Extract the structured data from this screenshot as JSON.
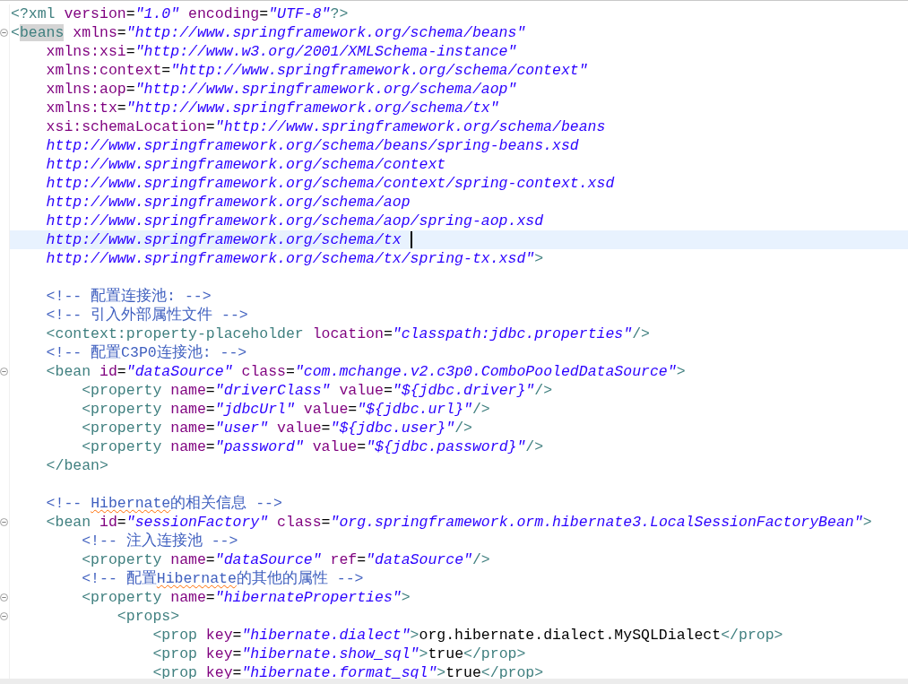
{
  "lines": [
    {
      "selected": false,
      "foldable": false,
      "tokens": [
        {
          "kind": "tag",
          "text": "<?xml"
        },
        {
          "kind": "attr",
          "text": " version"
        },
        {
          "kind": "text",
          "text": "="
        },
        {
          "kind": "value",
          "text": "\"1.0\""
        },
        {
          "kind": "attr",
          "text": " encoding"
        },
        {
          "kind": "text",
          "text": "="
        },
        {
          "kind": "value",
          "text": "\"UTF-8\""
        },
        {
          "kind": "tag",
          "text": "?>"
        }
      ]
    },
    {
      "selected": false,
      "foldable": true,
      "tokens": [
        {
          "kind": "tag",
          "text": "<"
        },
        {
          "kind": "tag-marked",
          "text": "beans"
        },
        {
          "kind": "attr",
          "text": " xmlns"
        },
        {
          "kind": "text",
          "text": "="
        },
        {
          "kind": "value",
          "text": "\"http://www.springframework.org/schema/beans\""
        }
      ]
    },
    {
      "selected": false,
      "foldable": false,
      "tokens": [
        {
          "kind": "attr",
          "text": "    xmlns:xsi"
        },
        {
          "kind": "text",
          "text": "="
        },
        {
          "kind": "value",
          "text": "\"http://www.w3.org/2001/XMLSchema-instance\""
        }
      ]
    },
    {
      "selected": false,
      "foldable": false,
      "tokens": [
        {
          "kind": "attr",
          "text": "    xmlns:context"
        },
        {
          "kind": "text",
          "text": "="
        },
        {
          "kind": "value",
          "text": "\"http://www.springframework.org/schema/context\""
        }
      ]
    },
    {
      "selected": false,
      "foldable": false,
      "tokens": [
        {
          "kind": "attr",
          "text": "    xmlns:aop"
        },
        {
          "kind": "text",
          "text": "="
        },
        {
          "kind": "value",
          "text": "\"http://www.springframework.org/schema/aop\""
        }
      ]
    },
    {
      "selected": false,
      "foldable": false,
      "tokens": [
        {
          "kind": "attr",
          "text": "    xmlns:tx"
        },
        {
          "kind": "text",
          "text": "="
        },
        {
          "kind": "value",
          "text": "\"http://www.springframework.org/schema/tx\""
        }
      ]
    },
    {
      "selected": false,
      "foldable": false,
      "tokens": [
        {
          "kind": "attr",
          "text": "    xsi:schemaLocation"
        },
        {
          "kind": "text",
          "text": "="
        },
        {
          "kind": "value",
          "text": "\"http://www.springframework.org/schema/beans"
        }
      ]
    },
    {
      "selected": false,
      "foldable": false,
      "tokens": [
        {
          "kind": "value",
          "text": "    http://www.springframework.org/schema/beans/spring-beans.xsd"
        }
      ]
    },
    {
      "selected": false,
      "foldable": false,
      "tokens": [
        {
          "kind": "value",
          "text": "    http://www.springframework.org/schema/context"
        }
      ]
    },
    {
      "selected": false,
      "foldable": false,
      "tokens": [
        {
          "kind": "value",
          "text": "    http://www.springframework.org/schema/context/spring-context.xsd"
        }
      ]
    },
    {
      "selected": false,
      "foldable": false,
      "tokens": [
        {
          "kind": "value",
          "text": "    http://www.springframework.org/schema/aop"
        }
      ]
    },
    {
      "selected": false,
      "foldable": false,
      "tokens": [
        {
          "kind": "value",
          "text": "    http://www.springframework.org/schema/aop/spring-aop.xsd"
        }
      ]
    },
    {
      "selected": true,
      "foldable": false,
      "tokens": [
        {
          "kind": "value",
          "text": "    http://www.springframework.org/schema/tx"
        }
      ]
    },
    {
      "selected": false,
      "foldable": false,
      "tokens": [
        {
          "kind": "value",
          "text": "    http://www.springframework.org/schema/tx/spring-tx.xsd\""
        },
        {
          "kind": "tag",
          "text": ">"
        }
      ]
    },
    {
      "selected": false,
      "foldable": false
    },
    {
      "selected": false,
      "foldable": false,
      "tokens": [
        {
          "kind": "comment",
          "text": "    <!-- 配置连接池: -->"
        }
      ]
    },
    {
      "selected": false,
      "foldable": false,
      "tokens": [
        {
          "kind": "comment",
          "text": "    <!-- 引入外部属性文件 -->"
        }
      ]
    },
    {
      "selected": false,
      "foldable": false,
      "tokens": [
        {
          "kind": "tag",
          "text": "    <context:property-placeholder"
        },
        {
          "kind": "attr",
          "text": " location"
        },
        {
          "kind": "text",
          "text": "="
        },
        {
          "kind": "value",
          "text": "\"classpath:jdbc.properties\""
        },
        {
          "kind": "tag",
          "text": "/>"
        }
      ]
    },
    {
      "selected": false,
      "foldable": false,
      "tokens": [
        {
          "kind": "comment",
          "text": "    <!-- 配置C3P0连接池: -->"
        }
      ]
    },
    {
      "selected": false,
      "foldable": true,
      "tokens": [
        {
          "kind": "tag",
          "text": "    <bean"
        },
        {
          "kind": "attr",
          "text": " id"
        },
        {
          "kind": "text",
          "text": "="
        },
        {
          "kind": "value",
          "text": "\"dataSource\""
        },
        {
          "kind": "attr",
          "text": " class"
        },
        {
          "kind": "text",
          "text": "="
        },
        {
          "kind": "value",
          "text": "\"com.mchange.v2.c3p0.ComboPooledDataSource\""
        },
        {
          "kind": "tag",
          "text": ">"
        }
      ]
    },
    {
      "selected": false,
      "foldable": false,
      "tokens": [
        {
          "kind": "tag",
          "text": "        <property"
        },
        {
          "kind": "attr",
          "text": " name"
        },
        {
          "kind": "text",
          "text": "="
        },
        {
          "kind": "value",
          "text": "\"driverClass\""
        },
        {
          "kind": "attr",
          "text": " value"
        },
        {
          "kind": "text",
          "text": "="
        },
        {
          "kind": "value",
          "text": "\"${jdbc.driver}\""
        },
        {
          "kind": "tag",
          "text": "/>"
        }
      ]
    },
    {
      "selected": false,
      "foldable": false,
      "tokens": [
        {
          "kind": "tag",
          "text": "        <property"
        },
        {
          "kind": "attr",
          "text": " name"
        },
        {
          "kind": "text",
          "text": "="
        },
        {
          "kind": "value",
          "text": "\"jdbcUrl\""
        },
        {
          "kind": "attr",
          "text": " value"
        },
        {
          "kind": "text",
          "text": "="
        },
        {
          "kind": "value",
          "text": "\"${jdbc.url}\""
        },
        {
          "kind": "tag",
          "text": "/>"
        }
      ]
    },
    {
      "selected": false,
      "foldable": false,
      "tokens": [
        {
          "kind": "tag",
          "text": "        <property"
        },
        {
          "kind": "attr",
          "text": " name"
        },
        {
          "kind": "text",
          "text": "="
        },
        {
          "kind": "value",
          "text": "\"user\""
        },
        {
          "kind": "attr",
          "text": " value"
        },
        {
          "kind": "text",
          "text": "="
        },
        {
          "kind": "value",
          "text": "\"${jdbc.user}\""
        },
        {
          "kind": "tag",
          "text": "/>"
        }
      ]
    },
    {
      "selected": false,
      "foldable": false,
      "tokens": [
        {
          "kind": "tag",
          "text": "        <property"
        },
        {
          "kind": "attr",
          "text": " name"
        },
        {
          "kind": "text",
          "text": "="
        },
        {
          "kind": "value",
          "text": "\"password\""
        },
        {
          "kind": "attr",
          "text": " value"
        },
        {
          "kind": "text",
          "text": "="
        },
        {
          "kind": "value",
          "text": "\"${jdbc.password}\""
        },
        {
          "kind": "tag",
          "text": "/>"
        }
      ]
    },
    {
      "selected": false,
      "foldable": false,
      "tokens": [
        {
          "kind": "tag",
          "text": "    </bean>"
        }
      ]
    },
    {
      "selected": false,
      "foldable": false
    },
    {
      "selected": false,
      "foldable": false,
      "tokens": [
        {
          "kind": "comment",
          "text": "    <!-- "
        },
        {
          "kind": "comment-misspelled",
          "text": "Hibernate"
        },
        {
          "kind": "comment",
          "text": "的相关信息 -->"
        }
      ]
    },
    {
      "selected": false,
      "foldable": true,
      "tokens": [
        {
          "kind": "tag",
          "text": "    <bean"
        },
        {
          "kind": "attr",
          "text": " id"
        },
        {
          "kind": "text",
          "text": "="
        },
        {
          "kind": "value",
          "text": "\"sessionFactory\""
        },
        {
          "kind": "attr",
          "text": " class"
        },
        {
          "kind": "text",
          "text": "="
        },
        {
          "kind": "value",
          "text": "\"org.springframework.orm.hibernate3.LocalSessionFactoryBean\""
        },
        {
          "kind": "tag",
          "text": ">"
        }
      ]
    },
    {
      "selected": false,
      "foldable": false,
      "tokens": [
        {
          "kind": "comment",
          "text": "        <!-- 注入连接池 -->"
        }
      ]
    },
    {
      "selected": false,
      "foldable": false,
      "tokens": [
        {
          "kind": "tag",
          "text": "        <property"
        },
        {
          "kind": "attr",
          "text": " name"
        },
        {
          "kind": "text",
          "text": "="
        },
        {
          "kind": "value",
          "text": "\"dataSource\""
        },
        {
          "kind": "attr",
          "text": " ref"
        },
        {
          "kind": "text",
          "text": "="
        },
        {
          "kind": "value",
          "text": "\"dataSource\""
        },
        {
          "kind": "tag",
          "text": "/>"
        }
      ]
    },
    {
      "selected": false,
      "foldable": false,
      "tokens": [
        {
          "kind": "comment",
          "text": "        <!-- 配置"
        },
        {
          "kind": "comment-misspelled",
          "text": "Hibernate"
        },
        {
          "kind": "comment",
          "text": "的其他的属性 -->"
        }
      ]
    },
    {
      "selected": false,
      "foldable": true,
      "tokens": [
        {
          "kind": "tag",
          "text": "        <property"
        },
        {
          "kind": "attr",
          "text": " name"
        },
        {
          "kind": "text",
          "text": "="
        },
        {
          "kind": "value",
          "text": "\"hibernateProperties\""
        },
        {
          "kind": "tag",
          "text": ">"
        }
      ]
    },
    {
      "selected": false,
      "foldable": true,
      "tokens": [
        {
          "kind": "tag",
          "text": "            <props>"
        }
      ]
    },
    {
      "selected": false,
      "foldable": false,
      "tokens": [
        {
          "kind": "tag",
          "text": "                <prop"
        },
        {
          "kind": "attr",
          "text": " key"
        },
        {
          "kind": "text",
          "text": "="
        },
        {
          "kind": "value",
          "text": "\"hibernate.dialect\""
        },
        {
          "kind": "tag",
          "text": ">"
        },
        {
          "kind": "text",
          "text": "org.hibernate.dialect.MySQLDialect"
        },
        {
          "kind": "tag",
          "text": "</prop>"
        }
      ]
    },
    {
      "selected": false,
      "foldable": false,
      "tokens": [
        {
          "kind": "tag",
          "text": "                <prop"
        },
        {
          "kind": "attr",
          "text": " key"
        },
        {
          "kind": "text",
          "text": "="
        },
        {
          "kind": "value",
          "text": "\"hibernate.show_sql\""
        },
        {
          "kind": "tag",
          "text": ">"
        },
        {
          "kind": "text",
          "text": "true"
        },
        {
          "kind": "tag",
          "text": "</prop>"
        }
      ]
    },
    {
      "selected": false,
      "foldable": false,
      "tokens": [
        {
          "kind": "tag",
          "text": "                <prop"
        },
        {
          "kind": "attr",
          "text": " key"
        },
        {
          "kind": "text",
          "text": "="
        },
        {
          "kind": "value",
          "text": "\"hibernate.format_sql\""
        },
        {
          "kind": "tag",
          "text": ">"
        },
        {
          "kind": "text",
          "text": "true"
        },
        {
          "kind": "tag",
          "text": "</prop>"
        }
      ]
    }
  ]
}
